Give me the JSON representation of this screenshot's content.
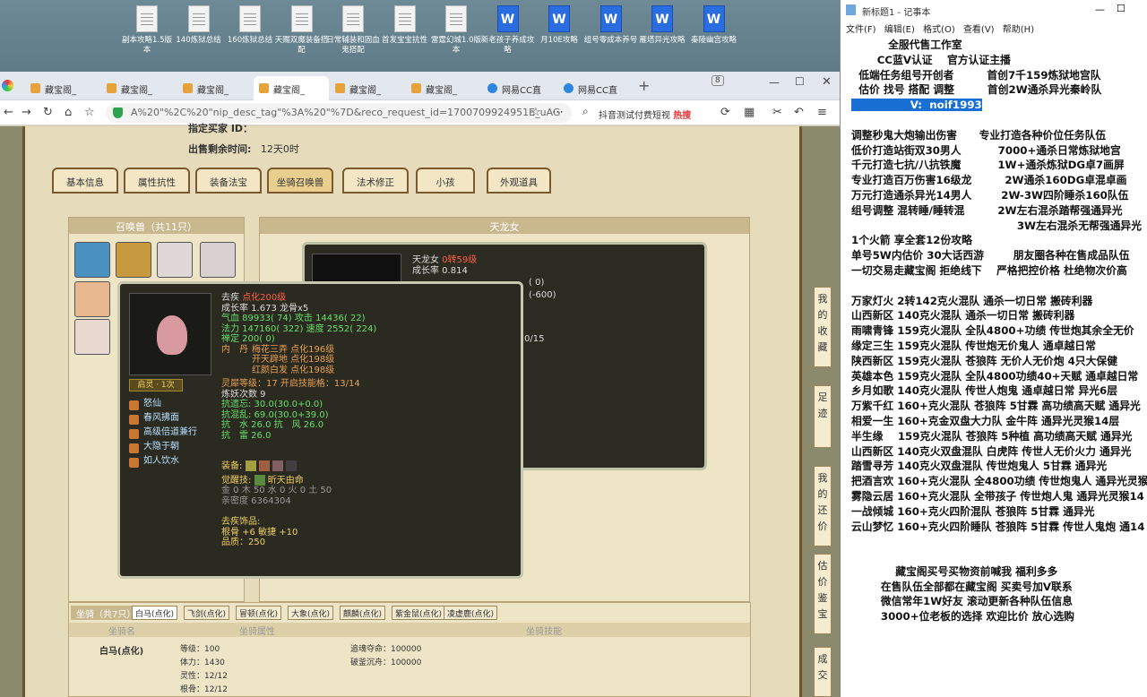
{
  "desktop": {
    "icons": [
      {
        "label": "副本攻略1.5版本",
        "type": "doc"
      },
      {
        "label": "140炼狱总结",
        "type": "doc"
      },
      {
        "label": "160炼狱总结",
        "type": "doc"
      },
      {
        "label": "天赐双魔装备搭配",
        "type": "doc"
      },
      {
        "label": "日常辅装和固血鬼搭配",
        "type": "doc"
      },
      {
        "label": "首发宝宝抗性",
        "type": "doc"
      },
      {
        "label": "雷霆幻城1.0版本",
        "type": "doc"
      },
      {
        "label": "新老孩子养成攻略",
        "type": "word"
      },
      {
        "label": "月10E攻略",
        "type": "word"
      },
      {
        "label": "组号零成本养号",
        "type": "word"
      },
      {
        "label": "雁塔异光攻略",
        "type": "word"
      },
      {
        "label": "秦陵幽宫攻略",
        "type": "word"
      }
    ]
  },
  "browser": {
    "tabs": [
      "藏宝阁_",
      "藏宝阁_",
      "藏宝阁_",
      "藏宝阁_",
      "藏宝阁_",
      "藏宝阁_",
      "网易CC直",
      "网易CC直"
    ],
    "active_tab": 3,
    "tab_count_badge": "8",
    "url": "A%20\"%2C%20\"nip_desc_tag\"%3A%20\"%7D&reco_request_id=1700709924951E_uAG",
    "search_text": "抖音测试付费短视",
    "hot_label": "热搜"
  },
  "game": {
    "seller_id_label": "指定买家 ID：",
    "time_left_label": "出售剩余时间:",
    "time_left_value": "12天0时",
    "tabs": [
      "基本信息",
      "属性抗性",
      "装备法宝",
      "坐骑召唤兽",
      "法术修正",
      "小孩",
      "外观道具"
    ],
    "pets_header": "召唤兽（共11只）",
    "detail_header": "天龙女",
    "bg_tooltip": {
      "name": "天龙女",
      "tag": "0转59级",
      "growth": "成长率 0.814",
      "v1": "( 0)",
      "v2": "(-600)",
      "v3": "0/15"
    },
    "tooltip": {
      "name": "去疾",
      "level": "点化200级",
      "growth": "成长率 1.673 龙骨x5",
      "hp": "气血 89933( 74)",
      "atk": "攻击 14436( 22)",
      "mp": "法力 147160( 322)",
      "spd": "速度 2552( 224)",
      "zen": "禅定 200( 0)",
      "neidan_title": "内　丹",
      "neidan": [
        "梅花三弄 点化196级",
        "开天辟地 点化198级",
        "红颜白发 点化198级"
      ],
      "lingxi": "灵犀等级：17 开启技能格：13/14",
      "lianyao": "炼妖次数 9",
      "resist": [
        "抗遗忘: 30.0(30.0+0.0)",
        "抗混乱: 69.0(30.0+39.0)",
        "抗　水 26.0 抗　风 26.0",
        "抗　雷 26.0"
      ],
      "badge": "启灵 · 1次",
      "skills": [
        "怒仙",
        "春风拂面",
        "高级倍道兼行",
        "大隐于朝",
        "如人饮水"
      ],
      "equip_label": "装备:",
      "awaken_label": "觉醒技:",
      "awaken": "昕天由命",
      "five": "金 0 木 50 水 0 火 0 土 50",
      "intimacy": "亲密度 6364304",
      "ornament_title": "去疾饰品:",
      "ornament1": "根骨 +6 敏捷 +10",
      "ornament2": "品质：250"
    },
    "mount": {
      "tab_label": "坐骑（共7只）",
      "tabs": [
        "白马(点化)",
        "飞剑(点化)",
        "冒顿(点化)",
        "大象(点化)",
        "麒麟(点化)",
        "紫金鼠(点化)",
        "凌虚鹿(点化)"
      ],
      "col1": "坐骑名",
      "col2": "坐骑属性",
      "col3": "坐骑技能",
      "name": "白马(点化)",
      "attrs": [
        "等级：100",
        "体力：1430",
        "灵性：12/12",
        "根骨：12/12"
      ],
      "skills": [
        "追魂夺命：100000",
        "破釜沉舟：100000"
      ]
    },
    "side_buttons": [
      "我的收藏",
      "足迹",
      "我的还价",
      "估价鉴宝",
      "成交"
    ]
  },
  "notepad": {
    "title": "新标题1 - 记事本",
    "menu": [
      "文件(F)",
      "编辑(E)",
      "格式(O)",
      "查看(V)",
      "帮助(H)"
    ],
    "lines": [
      "          全服代售工作室",
      "       CC蓝V认证    官方认证主播",
      "  低端任务组号开创者         首创7千159炼狱地宫队",
      "  估价 找号 搭配 调整         首创2W通杀异光秦岭队",
      "                V:  noif1993",
      "",
      "调整秒鬼大炮输出伤害      专业打造各种价位任务队伍",
      "低价打造站街双30男人          7000+通杀日常炼狱地宫",
      "千元打造七抗/八抗铁魔          1W+通杀炼狱DG卓7画屏",
      "专业打造百万伤害16级龙         2W通杀160DG卓混卓画",
      "万元打造通杀异光14男人        2W-3W四阶睡杀160队伍",
      "组号调整 混转睡/睡转混         2W左右混杀踏帮强通异光",
      "                                             3W左右混杀无帮强通异光",
      "1个火箭 享全套12份攻略",
      "单号5W内估价 30大话西游        朋友圈各种在售成品队伍",
      "一切交易走藏宝阁 拒绝线下    严格把控价格 杜绝物次价高",
      "",
      "万家灯火 2转142克火混队 通杀一切日常 搬砖利器",
      "山西新区 140克火混队 通杀一切日常 搬砖利器",
      "雨啸青锋 159克火混队 全队4800+功绩 传世炮其余全无价",
      "缘定三生 159克火混队 传世炮无价鬼人 通卓越日常",
      "陕西新区 159克火混队 苍狼阵 无价人无价炮 4只大保健",
      "英雄本色 159克火混队 全队4800功绩40+天赋 通卓越日常",
      "乡月如歌 140克火混队 传世人炮鬼 通卓越日常 异光6层",
      "万紫千红 160+克火混队 苍狼阵 5甘霖 高功绩高天赋 通异光",
      "相爱一生 160+克金双盘大力队 金牛阵 通异光灵猴14层",
      "半生缘    159克火混队 苍狼阵 5种植 高功绩高天赋 通异光",
      "山西新区 140克火双盘混队 白虎阵 传世人无价火力 通异光",
      "踏雪寻芳 140克火双盘混队 传世炮鬼人 5甘霖 通异光",
      "把酒言欢 160+克火混队 全4800功绩 传世炮鬼人 通异光灵猴",
      "雾隐云居 160+克火混队 全带孩子 传世炮人鬼 通异光灵猴14",
      "一战倾城 160+克火四阶混队 苍狼阵 5甘霖 通异光",
      "云山梦忆 160+克火四阶睡队 苍狼阵 5甘霖 传世人鬼炮 通14",
      "",
      "",
      "            藏宝阁买号买物资前喊我 福利多多",
      "        在售队伍全部都在藏宝阁 买卖号加V联系",
      "        微信常年1W好友 滚动更新各种队伍信息",
      "        3000+位老板的选择 欢迎比价 放心选购"
    ],
    "selected_line_index": 4
  },
  "colors": {
    "accent_green": "#68e068",
    "accent_red": "#ff5f3f",
    "selection": "#1a6fd4"
  }
}
